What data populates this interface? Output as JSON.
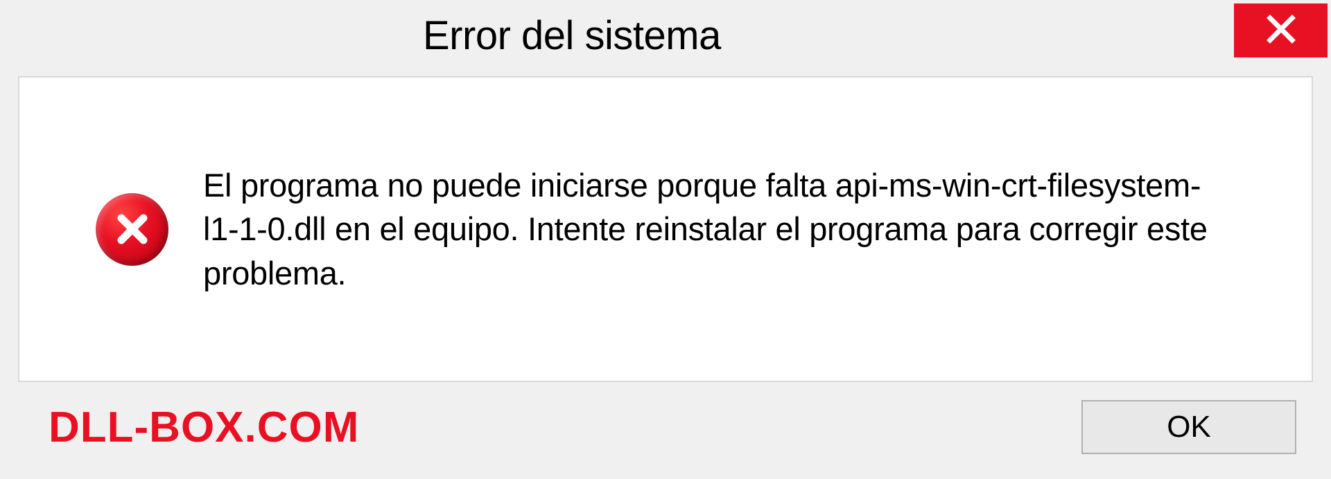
{
  "dialog": {
    "title": "Error del sistema",
    "message": "El programa no puede iniciarse porque falta api-ms-win-crt-filesystem-l1-1-0.dll en el equipo. Intente reinstalar el programa para corregir este problema.",
    "ok_label": "OK"
  },
  "watermark": "DLL-BOX.COM",
  "colors": {
    "close_red": "#e81123",
    "watermark_red": "#e81123"
  }
}
